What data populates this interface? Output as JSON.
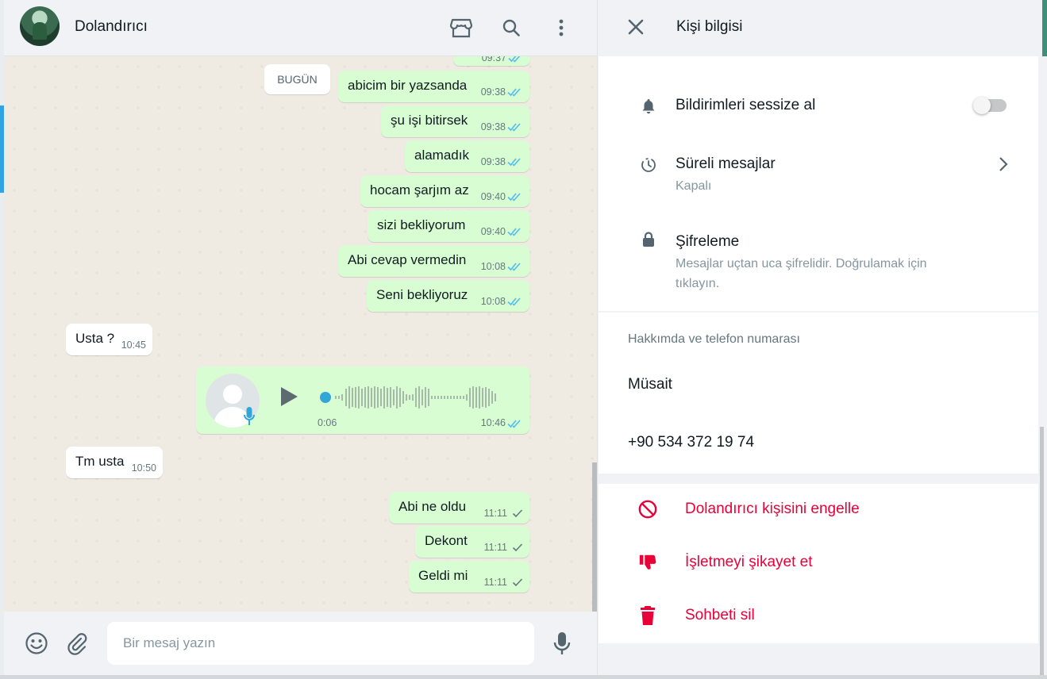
{
  "chat": {
    "contact_name": "Dolandırıcı",
    "header_icons": [
      "store-icon",
      "search-icon",
      "menu-dots-icon"
    ],
    "date_separator": "BUGÜN",
    "partial_top_time": "09:37",
    "messages": [
      {
        "dir": "out",
        "text": "abicim bir yazsanda",
        "time": "09:38",
        "status": "read"
      },
      {
        "dir": "out",
        "text": "şu işi bitirsek",
        "time": "09:38",
        "status": "read"
      },
      {
        "dir": "out",
        "text": "alamadık",
        "time": "09:38",
        "status": "read"
      },
      {
        "dir": "out",
        "text": "hocam şarjım az",
        "time": "09:40",
        "status": "read"
      },
      {
        "dir": "out",
        "text": "sizi bekliyorum",
        "time": "09:40",
        "status": "read"
      },
      {
        "dir": "out",
        "text": "Abi cevap vermedin",
        "time": "10:08",
        "status": "read"
      },
      {
        "dir": "out",
        "text": "Seni bekliyoruz",
        "time": "10:08",
        "status": "read"
      },
      {
        "dir": "in",
        "text": "Usta ?",
        "time": "10:45"
      },
      {
        "dir": "out",
        "type": "voice",
        "duration": "0:06",
        "time": "10:46",
        "status": "read"
      },
      {
        "dir": "in",
        "text": "Tm usta",
        "time": "10:50"
      },
      {
        "dir": "out",
        "text": "Abi ne oldu",
        "time": "11:11",
        "status": "sent"
      },
      {
        "dir": "out",
        "text": "Dekont",
        "time": "11:11",
        "status": "sent"
      },
      {
        "dir": "out",
        "text": "Geldi mi",
        "time": "11:11",
        "status": "sent"
      }
    ],
    "input_placeholder": "Bir mesaj yazın"
  },
  "info": {
    "title": "Kişi bilgisi",
    "mute": {
      "label": "Bildirimleri sessize al",
      "enabled": false
    },
    "disappearing": {
      "label": "Süreli mesajlar",
      "value": "Kapalı"
    },
    "encryption": {
      "label": "Şifreleme",
      "description": "Mesajlar uçtan uca şifrelidir. Doğrulamak için tıklayın."
    },
    "about_section_label": "Hakkımda ve telefon numarası",
    "about_text": "Müsait",
    "phone": "+90 534 372 19 74",
    "actions": {
      "block": "Dolandırıcı kişisini engelle",
      "report": "İşletmeyi şikayet et",
      "delete": "Sohbeti sil"
    }
  },
  "colors": {
    "outgoing_bubble": "#d9fdd3",
    "incoming_bubble": "#ffffff",
    "read_tick": "#53bdeb",
    "danger": "#ea0038",
    "chat_background": "#efeae2"
  }
}
